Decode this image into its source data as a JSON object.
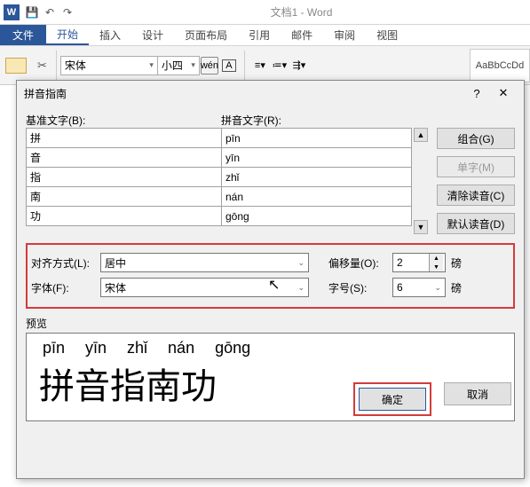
{
  "titlebar": {
    "doc": "文档1 - Word"
  },
  "tabs": {
    "file": "文件",
    "items": [
      "开始",
      "插入",
      "设计",
      "页面布局",
      "引用",
      "邮件",
      "审阅",
      "视图"
    ],
    "active_index": 0
  },
  "ribbon": {
    "font_name": "宋体",
    "font_size": "小四",
    "style_chip": "AaBbCcDd"
  },
  "dialog": {
    "title": "拼音指南",
    "base_label": "基准文字(B):",
    "ruby_label": "拼音文字(R):",
    "rows": [
      {
        "base": "拼",
        "ruby": "pīn"
      },
      {
        "base": "音",
        "ruby": "yīn"
      },
      {
        "base": "指",
        "ruby": "zhǐ"
      },
      {
        "base": "南",
        "ruby": "nán"
      },
      {
        "base": "功",
        "ruby": "gōng"
      }
    ],
    "side": {
      "combine": "组合(G)",
      "single": "单字(M)",
      "clear": "清除读音(C)",
      "default": "默认读音(D)"
    },
    "align_label": "对齐方式(L):",
    "align_value": "居中",
    "offset_label": "偏移量(O):",
    "offset_value": "2",
    "offset_unit": "磅",
    "font_label": "字体(F):",
    "font_value": "宋体",
    "size_label": "字号(S):",
    "size_value": "6",
    "size_unit": "磅",
    "preview_label": "预览",
    "preview_pinyin": "pīn yīn zhǐ nán gōng",
    "preview_hanzi": "拼音指南功",
    "ok": "确定",
    "cancel": "取消"
  }
}
